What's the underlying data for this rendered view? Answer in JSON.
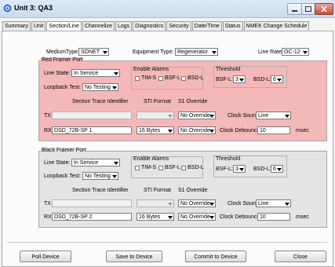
{
  "window": {
    "title": "Unit 3: QA3"
  },
  "tabs": [
    "Summary",
    "Unit",
    "Section/Line",
    "Channelize",
    "Logs",
    "Diagnostics",
    "Security",
    "Date/Time",
    "Status",
    "NMEK Change Schedule"
  ],
  "top": {
    "medium_type_label": "MediumType:",
    "medium_type_value": "SONET",
    "equipment_type_label": "Equipment Type:",
    "equipment_type_value": "Regenerator",
    "line_rate_label": "Line Rate:",
    "line_rate_value": "OC-12"
  },
  "red_port": {
    "legend": "Red Framer Port",
    "line_state_label": "Line State:",
    "line_state_value": "In Service",
    "loopback_label": "Loopback Test:",
    "loopback_value": "No Testing",
    "enable_alarms_legend": "Enable Alarms",
    "alarms": [
      "TIM-S",
      "BSF-L",
      "BSD-L"
    ],
    "threshold_legend": "Threshold",
    "bsf_label": "BSF-L:",
    "bsf_value": "3",
    "bsd_label": "BSD-L:",
    "bsd_value": "6",
    "sti_header": "Section Trace Identifier",
    "sti_format_header": "STI Format",
    "s1_override_header": "S1 Override",
    "tx_label": "TX",
    "tx_value": "",
    "tx_format": "",
    "tx_override": "No Override",
    "rx_label": "RX",
    "rx_value": "DSD_72B-SP 1",
    "rx_format": "16 Bytes",
    "rx_override": "No Override",
    "clock_source_label": "Clock Source:",
    "clock_source_value": "Line",
    "clock_debounce_label": "Clock Debounce:",
    "clock_debounce_value": "10",
    "unit": "msec"
  },
  "black_port": {
    "legend": "Black Framer Port",
    "line_state_label": "Line State:",
    "line_state_value": "In Service",
    "loopback_label": "Loopback Test:",
    "loopback_value": "No Testing",
    "enable_alarms_legend": "Enable Alarms",
    "alarms": [
      "TIM-S",
      "BSF-L",
      "BSD-L"
    ],
    "threshold_legend": "Threshold",
    "bsf_label": "BSF-L:",
    "bsf_value": "3",
    "bsd_label": "BSD-L:",
    "bsd_value": "6",
    "sti_header": "Section Trace Identifier",
    "sti_format_header": "STI Format",
    "s1_override_header": "S1 Override",
    "tx_label": "TX",
    "tx_value": "",
    "tx_format": "",
    "tx_override": "No Override",
    "rx_label": "RX",
    "rx_value": "DSD_72B-SP 2",
    "rx_format": "16 Bytes",
    "rx_override": "No Override",
    "clock_source_label": "Clock Source:",
    "clock_source_value": "Line",
    "clock_debounce_label": "Clock Debounce:",
    "clock_debounce_value": "10",
    "unit": "msec"
  },
  "buttons": {
    "poll": "Poll Device",
    "save": "Save to Device",
    "commit": "Commit to Device",
    "close": "Close"
  }
}
